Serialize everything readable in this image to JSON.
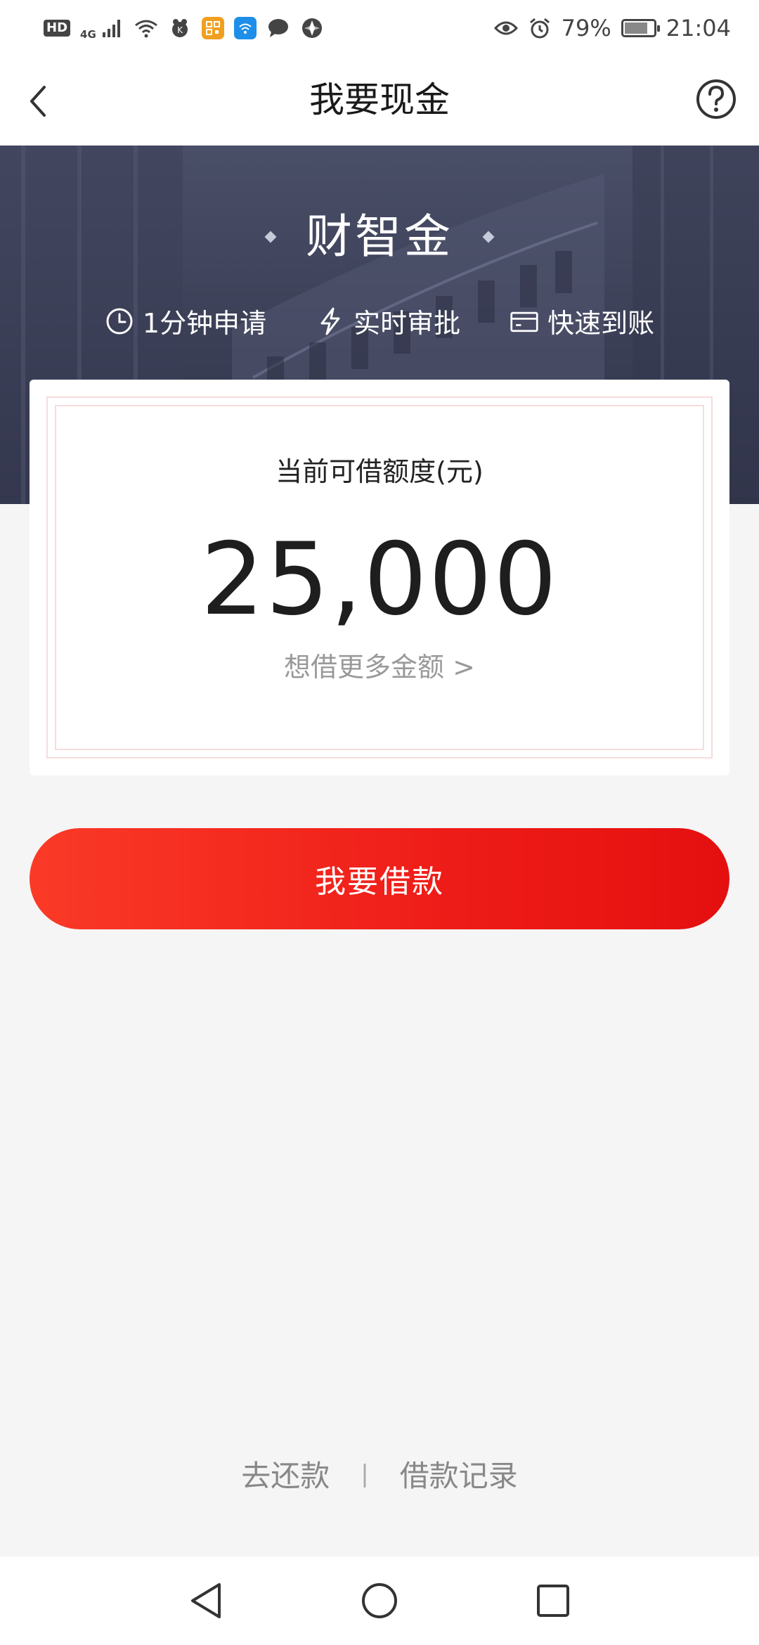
{
  "status_bar": {
    "hd": "HD",
    "network": "4G",
    "battery_percent": "79%",
    "battery_level": 0.79,
    "time": "21:04",
    "icons": [
      "hd-icon",
      "signal-icon",
      "wifi-icon",
      "app-icon",
      "qr-app-icon",
      "wifi-app-icon",
      "chat-icon",
      "compass-icon",
      "eye-icon",
      "alarm-icon",
      "battery-icon"
    ]
  },
  "nav": {
    "title": "我要现金",
    "back_icon": "chevron-left-icon",
    "help_icon": "question-circle-icon"
  },
  "hero": {
    "brand_name": "财智金",
    "features": [
      {
        "icon": "clock-icon",
        "label": "1分钟申请"
      },
      {
        "icon": "lightning-icon",
        "label": "实时审批"
      },
      {
        "icon": "card-icon",
        "label": "快速到账"
      }
    ]
  },
  "credit": {
    "label": "当前可借额度(元)",
    "amount": "25,000",
    "more_link": "想借更多金额 >"
  },
  "actions": {
    "borrow_label": "我要借款"
  },
  "footer": {
    "repay_label": "去还款",
    "separator": "|",
    "records_label": "借款记录"
  },
  "colors": {
    "primary_red": "#ee1c18",
    "hero_bg": "#3b3f56",
    "page_bg": "#f5f5f5"
  }
}
